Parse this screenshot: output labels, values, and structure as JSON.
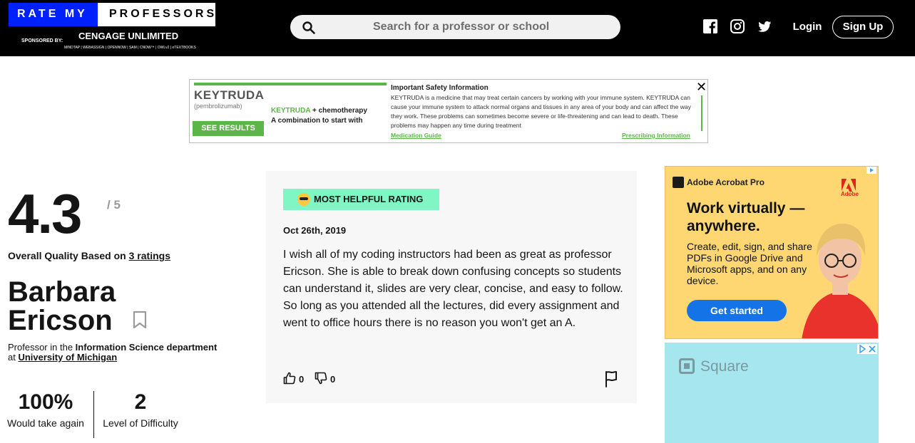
{
  "header": {
    "logo_text_blue": "RATE MY",
    "logo_text_white": "PROFESSORS",
    "sponsor_label": "SPONSORED BY:",
    "sponsor_name": "CENGAGE UNLIMITED",
    "sponsor_sub": "MINDTAP | WEBASSIGN | OPENNOW | SAM | CNOW™ | OWLv2 | eTEXTBOOKS",
    "search_placeholder": "Search for a professor or school",
    "login_label": "Login",
    "signup_label": "Sign Up",
    "social": [
      "facebook-icon",
      "instagram-icon",
      "twitter-icon"
    ]
  },
  "top_ad": {
    "brand": "KEYTRUDA",
    "brand_sub": "(pembrolizumab)",
    "button": "SEE RESULTS",
    "line1_brand": "KEYTRUDA",
    "line1_rest": "+ chemotherapy",
    "line2": "A combination to start with",
    "isi_title": "Important Safety Information",
    "isi_text": "KEYTRUDA is a medicine that may treat certain cancers by working with your immune system. KEYTRUDA can cause your immune system to attack normal organs and tissues in any area of your body and can affect the way they work. These problems can sometimes become severe or life-threatening and can lead to death. These problems may happen any time during treatment",
    "link1": "Medication Guide",
    "link2": "Prescribing Information"
  },
  "professor": {
    "rating": "4.3",
    "rating_max": "/ 5",
    "overall_prefix": "Overall Quality Based on ",
    "ratings_link": "3 ratings",
    "first_name": "Barbara",
    "last_name": "Ericson",
    "dept_prefix": "Professor in the ",
    "dept_name": "Information Science department",
    "at_label": "at ",
    "school": "University of Michigan",
    "take_again_value": "100%",
    "take_again_label": "Would take again",
    "difficulty_value": "2",
    "difficulty_label": "Level of Difficulty"
  },
  "review": {
    "tag": "MOST HELPFUL RATING",
    "date": "Oct 26th, 2019",
    "text": "I wish all of my coding instructors had been as great as professor Ericson. She is able to break down confusing concepts so students can understand it, slides are very clear, concise, and easy to follow. So long as you attended all the lectures, did every assignment and went to office hours there is no reason you won't get an A.",
    "thumbs_up": "0",
    "thumbs_down": "0"
  },
  "ad_acrobat": {
    "brand": "Adobe Acrobat Pro",
    "adobe_label": "Adobe",
    "headline": "Work virtually — anywhere.",
    "body": "Create, edit, sign, and share PDFs in Google Drive and Microsoft apps, and on any device.",
    "button": "Get started"
  },
  "ad_square": {
    "brand": "Square"
  }
}
